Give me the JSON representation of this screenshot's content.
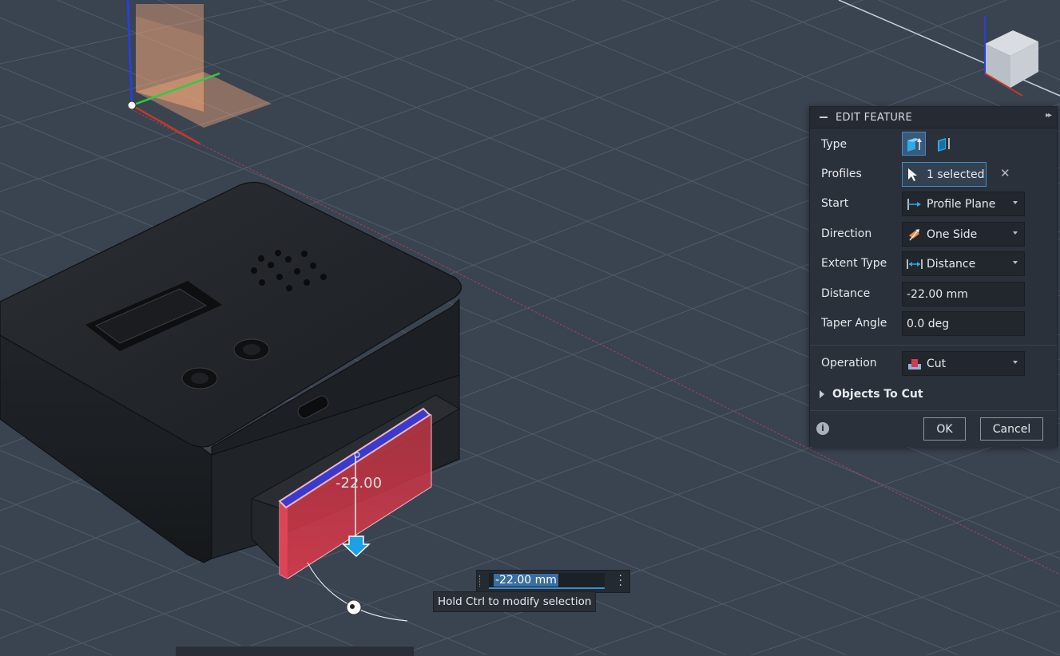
{
  "panel": {
    "title": "EDIT FEATURE",
    "type_label": "Type",
    "profiles_label": "Profiles",
    "profiles_value": "1 selected",
    "start_label": "Start",
    "start_value": "Profile Plane",
    "direction_label": "Direction",
    "direction_value": "One Side",
    "extent_label": "Extent Type",
    "extent_value": "Distance",
    "distance_label": "Distance",
    "distance_value": "-22.00 mm",
    "taper_label": "Taper Angle",
    "taper_value": "0.0 deg",
    "operation_label": "Operation",
    "operation_value": "Cut",
    "objects_label": "Objects To Cut",
    "ok_label": "OK",
    "cancel_label": "Cancel",
    "info_icon": "i"
  },
  "viewport": {
    "dimension_label": "-22.00",
    "dimension_input": "-22.00 mm",
    "hint": "Hold Ctrl to modify selection"
  },
  "colors": {
    "background": "#3a4350",
    "grid": "#4f5966",
    "panel": "#2b313a",
    "accent": "#3a8fd0",
    "cut_body": "#c8323f",
    "x_axis": "#c0392b",
    "y_axis": "#2ecc40",
    "z_axis": "#2b3fd6"
  }
}
